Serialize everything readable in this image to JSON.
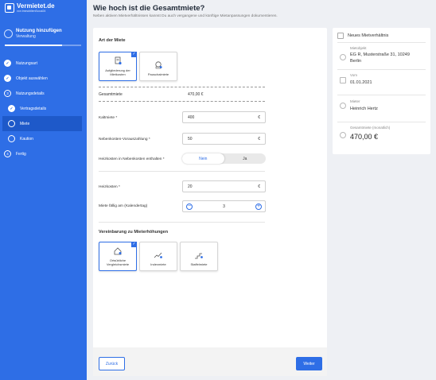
{
  "brand": {
    "name": "Vermietet.de",
    "sub": "von ImmobilienScout24"
  },
  "flow": {
    "title": "Nutzung hinzufügen",
    "subtitle": "Verwaltung",
    "progress_fraction": 0.75
  },
  "steps": [
    {
      "label": "Nutzungsart",
      "state": "done"
    },
    {
      "label": "Objekt auswählen",
      "state": "done"
    },
    {
      "label": "Nutzungsdetails",
      "state": "number",
      "number": "3"
    },
    {
      "label": "Vertragsdetails",
      "state": "done",
      "sub": true
    },
    {
      "label": "Miete",
      "state": "current",
      "sub": true
    },
    {
      "label": "Kaution",
      "state": "pending",
      "sub": true
    },
    {
      "label": "Fertig",
      "state": "number",
      "number": "4"
    }
  ],
  "page": {
    "title": "Wie hoch ist die Gesamtmiete?",
    "subtitle": "Neben aktiven Mietverhältnissen kannst Du auch vergangene und künftige Mietanpassungen dokumentieren."
  },
  "rent_type": {
    "title": "Art der Miete",
    "options": [
      {
        "label": "Aufgliederung der Mietkosten",
        "selected": true
      },
      {
        "label": "Pauschalmiete",
        "selected": false
      }
    ]
  },
  "total": {
    "label": "Gesamtmiete",
    "value": "470,00 €"
  },
  "fields": {
    "kaltmiete": {
      "label": "Kaltmiete *",
      "value": "400",
      "unit": "€"
    },
    "nebenkosten": {
      "label": "Nebenkosten-Vorauszahlung *",
      "value": "50",
      "unit": "€"
    },
    "heizkosten_toggle": {
      "label": "Heizkosten in Nebenkosten enthalten *",
      "no": "Nein",
      "yes": "Ja",
      "selected": "Nein"
    },
    "heizkosten": {
      "label": "Heizkosten *",
      "value": "20",
      "unit": "€"
    },
    "faellig": {
      "label": "Miete fällig am (Kalendertag)",
      "value": "3",
      "minus": "−",
      "plus": "+"
    }
  },
  "increase": {
    "title": "Vereinbarung zu Mieterhöhungen",
    "options": [
      {
        "label": "Ortsübliche Vergleichsmiete",
        "selected": true
      },
      {
        "label": "Indexmiete",
        "selected": false
      },
      {
        "label": "Staffelmiete",
        "selected": false
      }
    ]
  },
  "buttons": {
    "back": "Zurück",
    "next": "Weiter"
  },
  "summary": {
    "title": "Neues Mietverhältnis",
    "object_label": "Mietobjekt",
    "object_line1": "EG R, Musterstraße 31, 10249",
    "object_line2": "Berlin",
    "from_label": "Vom",
    "from_value": "01.01.2021",
    "tenant_label": "Mieter",
    "tenant_value": "Heinrich Hertz",
    "rent_label": "Gesamtmiete (monatlich)",
    "rent_value": "470,00 €"
  },
  "colors": {
    "primary": "#2e6ee6",
    "sidebar": "#2e6ee6",
    "background": "#eef0f4"
  }
}
